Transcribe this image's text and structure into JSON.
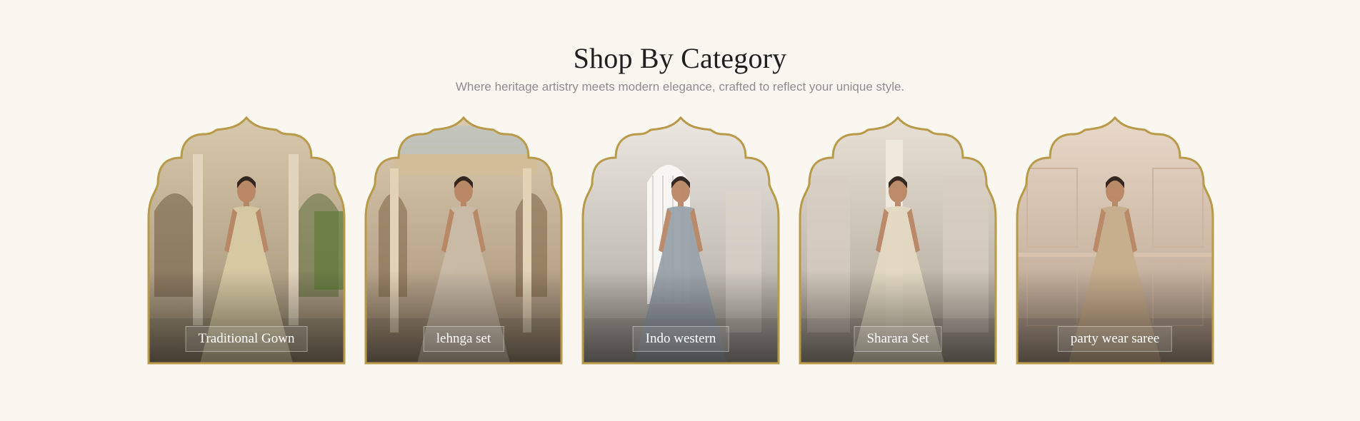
{
  "section": {
    "title": "Shop By Category",
    "subtitle": "Where heritage artistry meets modern elegance, crafted to reflect your unique style."
  },
  "categories": [
    {
      "label": "Traditional Gown",
      "scene": "palace-arches-garden",
      "bg_top": "#d8c9ac",
      "bg_bottom": "#9e8e74",
      "dress": "#d8caa3"
    },
    {
      "label": "lehnga set",
      "scene": "palace-courtyard",
      "bg_top": "#dccbb0",
      "bg_bottom": "#a38f75",
      "dress": "#c9bba7"
    },
    {
      "label": "Indo western",
      "scene": "white-arched-room",
      "bg_top": "#ece8e1",
      "bg_bottom": "#a9a49b",
      "dress": "#9aa3ab"
    },
    {
      "label": "Sharara Set",
      "scene": "ivory-hall",
      "bg_top": "#e9e1d6",
      "bg_bottom": "#aaa193",
      "dress": "#e4dac3"
    },
    {
      "label": "party wear saree",
      "scene": "blush-panel-wall",
      "bg_top": "#e9d9c8",
      "bg_bottom": "#b39d89",
      "dress": "#c7ae8c"
    }
  ],
  "colors": {
    "background": "#faf7f1",
    "frame_gold": "#b89a49",
    "title": "#1f1f1f",
    "subtitle": "#8d8d8d"
  }
}
